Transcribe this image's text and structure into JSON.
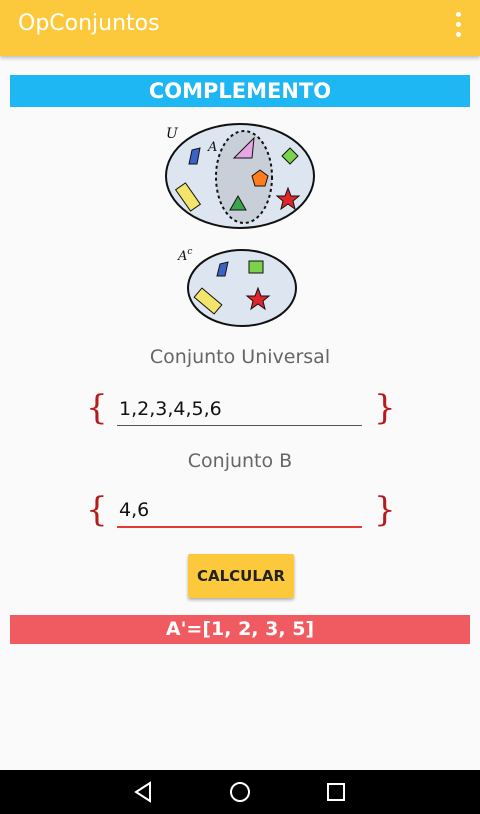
{
  "appbar": {
    "title": "OpConjuntos",
    "menu_icon": "more-vert-icon"
  },
  "section": {
    "title": "COMPLEMENTO"
  },
  "diagram": {
    "universe_label": "U",
    "set_label": "A",
    "complement_label": "A",
    "complement_sup": "c"
  },
  "form": {
    "universal_label": "Conjunto Universal",
    "universal_value": "1,2,3,4,5,6",
    "set_b_label": "Conjunto B",
    "set_b_value": "4,6",
    "open_brace": "{",
    "close_brace": "}"
  },
  "actions": {
    "calculate_label": "CALCULAR"
  },
  "result": {
    "text": "A'=[1, 2, 3, 5]"
  },
  "navbar": {
    "back_icon": "back-triangle-icon",
    "home_icon": "home-circle-icon",
    "recents_icon": "recents-square-icon"
  },
  "colors": {
    "appbar": "#fdc93c",
    "header": "#1eb6f3",
    "result": "#ef5b60",
    "brace": "#b71c1c"
  }
}
